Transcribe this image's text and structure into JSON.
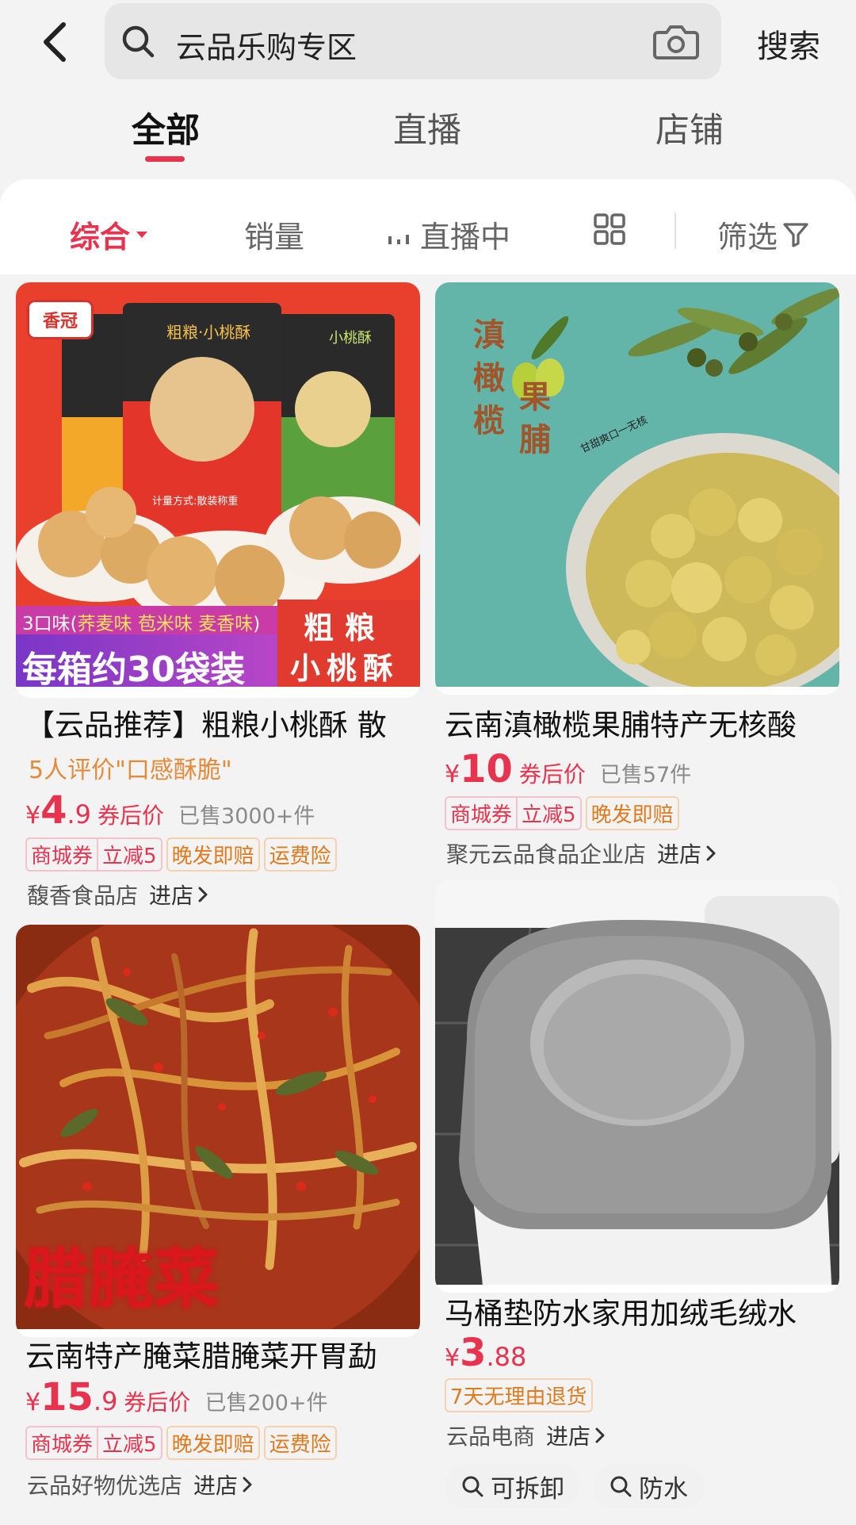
{
  "search": {
    "query": "云品乐购专区",
    "button_label": "搜索"
  },
  "tabs": [
    {
      "label": "全部",
      "active": true
    },
    {
      "label": "直播",
      "active": false
    },
    {
      "label": "店铺",
      "active": false
    }
  ],
  "filters": {
    "sort": "综合",
    "sales": "销量",
    "live": "直播中",
    "filter": "筛选"
  },
  "colors": {
    "accent": "#e8334f",
    "review": "#e58a3a",
    "orange_tag": "#e07a1c"
  },
  "products": [
    {
      "title": "【云品推荐】粗粮小桃酥 散",
      "review": "5人评价\"口感酥脆\"",
      "price_currency": "¥",
      "price_int": "4",
      "price_dec": ".9",
      "price_note": "券后价",
      "sold": "已售3000+件",
      "tags": {
        "coupon": "商城券",
        "discount": "立减5",
        "late": "晚发即赔",
        "shipping": "运费险"
      },
      "shop": "馥香食品店",
      "enter": "进店",
      "photo_text": {
        "logo": "香冠",
        "flavors_lead": "3口味(",
        "flavors": "荞麦味 苞米味 麦香味",
        "flavors_end": ")",
        "headline": "每箱约30袋装",
        "name_top": "粗粮",
        "name_bottom": "小桃酥",
        "bag_label": "粗粮·小桃酥",
        "bag_side": "小桃酥",
        "bag_weight": "计量方式:散装称重"
      }
    },
    {
      "title": "云南滇橄榄果脯特产无核酸",
      "price_currency": "¥",
      "price_int": "10",
      "price_note": "券后价",
      "sold": "已售57件",
      "tags": {
        "coupon": "商城券",
        "discount": "立减5",
        "late": "晚发即赔"
      },
      "shop": "聚元云品食品企业店",
      "enter": "进店",
      "photo_text": {
        "col1": "滇橄榄",
        "col2": "果脯",
        "slogan": "甘甜爽口一无核"
      }
    },
    {
      "title": "云南特产腌菜腊腌菜开胃勐",
      "price_currency": "¥",
      "price_int": "15",
      "price_dec": ".9",
      "price_note": "券后价",
      "sold": "已售200+件",
      "tags": {
        "coupon": "商城券",
        "discount": "立减5",
        "late": "晚发即赔",
        "shipping": "运费险"
      },
      "shop": "云品好物优选店",
      "enter": "进店",
      "photo_text": {
        "headline": "腊腌菜"
      }
    },
    {
      "title": "马桶垫防水家用加绒毛绒水",
      "price_currency": "¥",
      "price_int": "3",
      "price_dec": ".88",
      "tags": {
        "return": "7天无理由退货"
      },
      "shop": "云品电商",
      "enter": "进店",
      "chips": [
        "可拆卸",
        "防水"
      ]
    }
  ]
}
